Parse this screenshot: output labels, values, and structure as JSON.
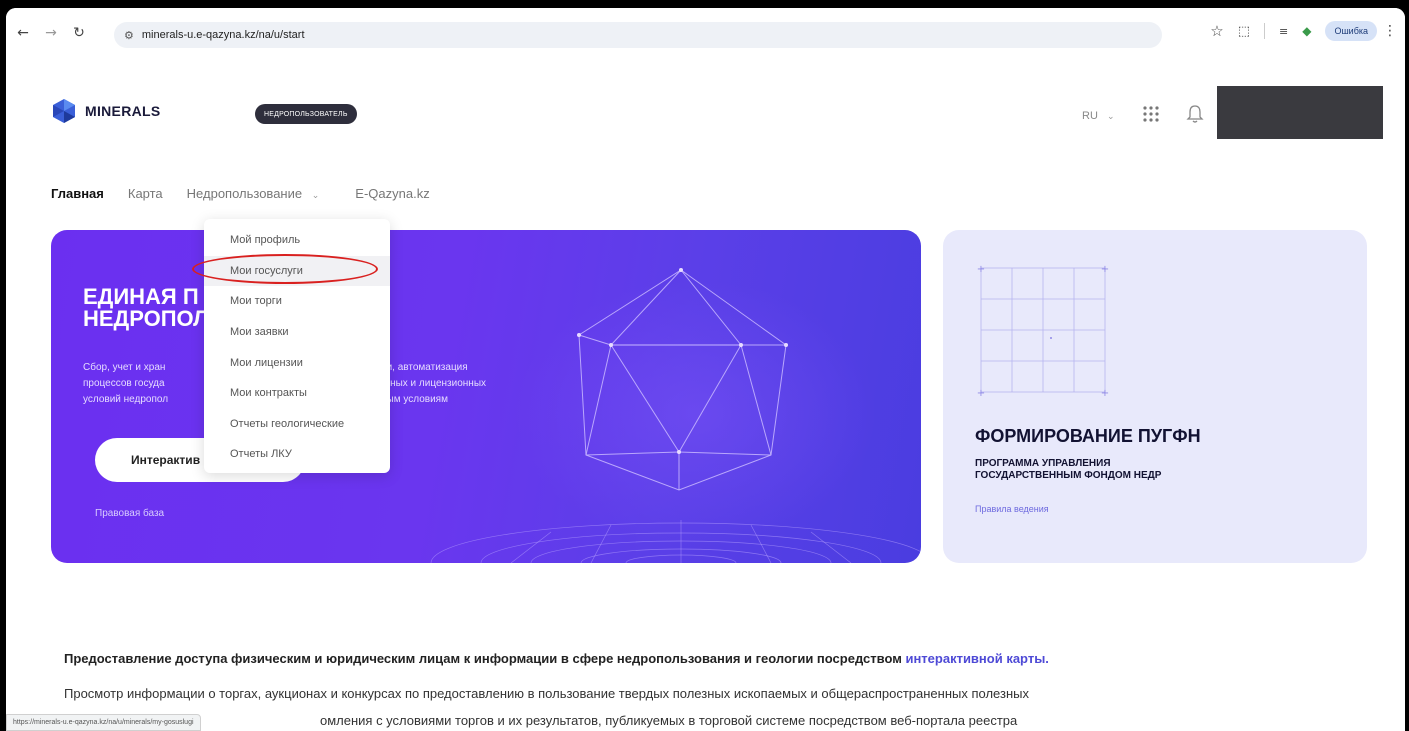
{
  "browser": {
    "url": "minerals-u.e-qazyna.kz/na/u/start",
    "error_label": "Ошибка",
    "status_url": "https://minerals-u.e-qazyna.kz/na/u/minerals/my-gosuslugi"
  },
  "header": {
    "logo_text": "MINERALS",
    "role_badge": "НЕДРОПОЛЬЗОВАТЕЛЬ",
    "lang": "RU",
    "lang_chevron": "⌄"
  },
  "nav": {
    "items": [
      {
        "label": "Главная"
      },
      {
        "label": "Карта"
      },
      {
        "label": "Недропользование"
      },
      {
        "label": "E-Qazyna.kz"
      }
    ],
    "chevron": "⌄"
  },
  "dropdown": {
    "items": [
      {
        "label": "Мой профиль"
      },
      {
        "label": "Мои госуслуги"
      },
      {
        "label": "Мои торги"
      },
      {
        "label": "Мои заявки"
      },
      {
        "label": "Мои лицензии"
      },
      {
        "label": "Мои контракты"
      },
      {
        "label": "Отчеты геологические"
      },
      {
        "label": "Отчеты ЛКУ"
      }
    ]
  },
  "hero": {
    "title_line1": "ЕДИНАЯ П",
    "title_line2": "НЕДРОПОЛ",
    "desc_left": [
      "Сбор, учет и хран",
      "процессов госуда",
      "условий недропол"
    ],
    "desc_right": [
      "ии, автоматизация",
      "ктных и лицензионных",
      "ным условиям"
    ],
    "button_label": "Интерактив",
    "link_label": "Правовая база"
  },
  "card": {
    "title": "ФОРМИРОВАНИЕ ПУГФН",
    "subtitle_line1": "ПРОГРАММА УПРАВЛЕНИЯ",
    "subtitle_line2": "ГОСУДАРСТВЕННЫМ ФОНДОМ НЕДР",
    "link_label": "Правила ведения"
  },
  "content": {
    "para1_text": "Предоставление доступа физическим и юридическим лицам к информации в сфере недропользования и геологии посредством ",
    "para1_link": "интерактивной карты.",
    "para2": "Просмотр информации о торгах, аукционах и конкурсах по предоставлению в пользование твердых полезных ископаемых и общераспространенных полезных",
    "para3": "омления с условиями торгов и их результатов, публикуемых в торговой системе посредством веб-портала реестра"
  },
  "colors": {
    "accent": "#6b2ff0",
    "highlight_circle": "#d9201f",
    "link": "#4e4ad6"
  }
}
